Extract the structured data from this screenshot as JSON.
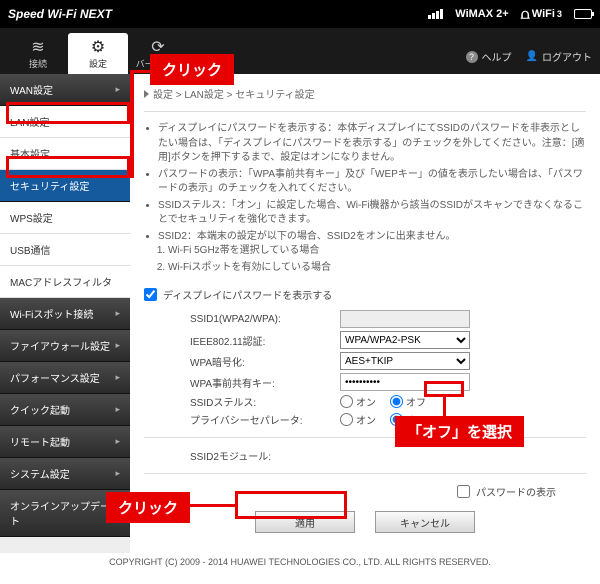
{
  "brand": "Speed Wi-Fi NEXT",
  "status": {
    "wimax": "WiMAX 2+",
    "wifi": "WiFi",
    "wifi_sub": "3"
  },
  "nav": {
    "tabs": [
      {
        "icon": "≋",
        "label": "接続"
      },
      {
        "icon": "⚙",
        "label": "設定"
      },
      {
        "icon": "⟳",
        "label": "バージョン"
      }
    ],
    "help": "ヘルプ",
    "logout": "ログアウト"
  },
  "sidebar": [
    {
      "label": "WAN設定",
      "type": "hdr"
    },
    {
      "label": "LAN設定",
      "type": "sub"
    },
    {
      "label": "基本設定",
      "type": "sub"
    },
    {
      "label": "セキュリティ設定",
      "type": "sel"
    },
    {
      "label": "WPS設定",
      "type": "sub"
    },
    {
      "label": "USB通信",
      "type": "sub"
    },
    {
      "label": "MACアドレスフィルタ",
      "type": "sub"
    },
    {
      "label": "Wi-Fiスポット接続",
      "type": "hdr"
    },
    {
      "label": "ファイアウォール設定",
      "type": "hdr"
    },
    {
      "label": "パフォーマンス設定",
      "type": "hdr"
    },
    {
      "label": "クイック起動",
      "type": "hdr"
    },
    {
      "label": "リモート起動",
      "type": "hdr"
    },
    {
      "label": "システム設定",
      "type": "hdr"
    },
    {
      "label": "オンラインアップデート",
      "type": "hdr"
    }
  ],
  "breadcrumb": "設定 > LAN設定 > セキュリティ設定",
  "bullets": {
    "b1": "ディスプレイにパスワードを表示する：本体ディスプレイにてSSIDのパスワードを非表示としたい場合は、「ディスプレイにパスワードを表示する」のチェックを外してください。注意：[適用]ボタンを押下するまで、設定はオンになりません。",
    "b2": "パスワードの表示：「WPA事前共有キー」及び「WEPキー」の値を表示したい場合は、「パスワードの表示」のチェックを入れてください。",
    "b3": "SSIDステルス：「オン」に設定した場合、Wi-Fi機器から該当のSSIDがスキャンできなくなることでセキュリティを強化できます。",
    "b4": "SSID2：本端末の設定が以下の場合、SSID2をオンに出来ません。",
    "b4_1": "Wi-Fi 5GHz帯を選択している場合",
    "b4_2": "Wi-Fiスポットを有効にしている場合"
  },
  "check_display_pw": "ディスプレイにパスワードを表示する",
  "form": {
    "ssid1_lab": "SSID1(WPA2/WPA):",
    "ssid1_val": "",
    "auth_lab": "IEEE802.11認証:",
    "auth_val": "WPA/WPA2-PSK",
    "enc_lab": "WPA暗号化:",
    "enc_val": "AES+TKIP",
    "psk_lab": "WPA事前共有キー:",
    "psk_val": "••••••••••",
    "stealth_lab": "SSIDステルス:",
    "on": "オン",
    "off": "オフ",
    "priv_lab": "プライバシーセパレータ:",
    "ssid2_lab": "SSID2モジュール:",
    "showpw": "パスワードの表示"
  },
  "buttons": {
    "apply": "適用",
    "cancel": "キャンセル"
  },
  "copyright": "COPYRIGHT (C) 2009 - 2014 HUAWEI TECHNOLOGIES CO., LTD. ALL RIGHTS RESERVED.",
  "callouts": {
    "click": "クリック",
    "off": "「オフ」を選択"
  }
}
